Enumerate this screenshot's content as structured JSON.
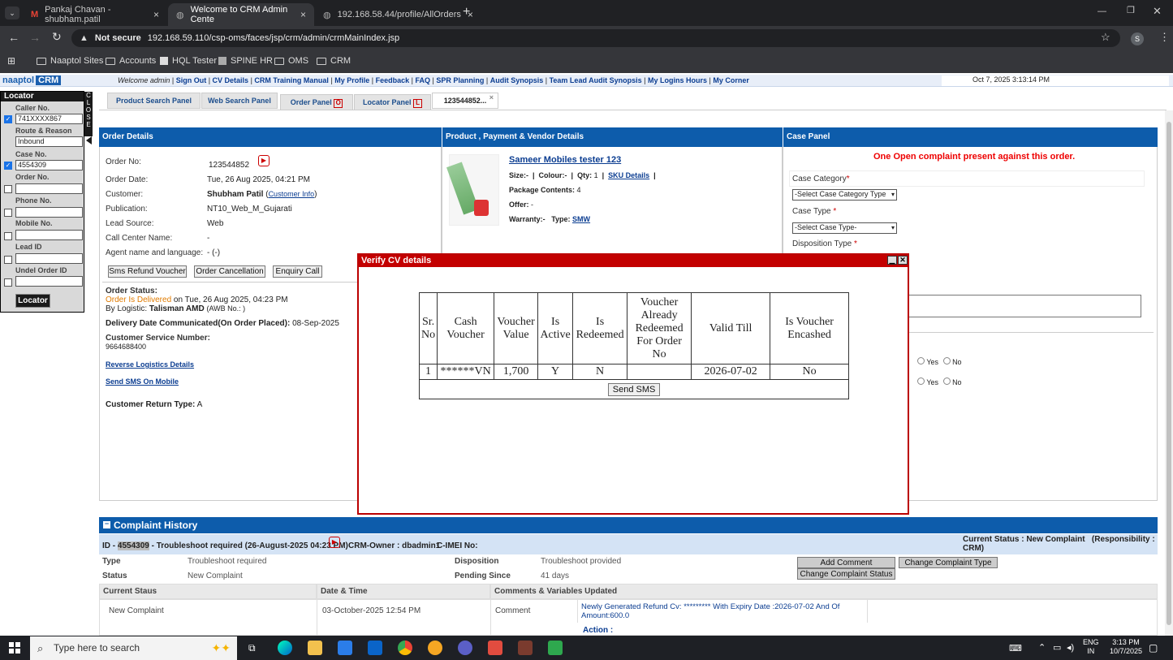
{
  "browser": {
    "tabs": [
      {
        "label": "Pankaj Chavan - shubham.patil"
      },
      {
        "label": "Welcome to CRM Admin Cente"
      },
      {
        "label": "192.168.58.44/profile/AllOrders"
      }
    ],
    "security": "Not secure",
    "url": "192.168.59.110/csp-oms/faces/jsp/crm/admin/crmMainIndex.jsp",
    "profile_initial": "S",
    "bookmarks": [
      "Naaptol Sites",
      "Accounts",
      "HQL Tester",
      "SPINE HR",
      "OMS",
      "CRM"
    ]
  },
  "app": {
    "logo_text": "naaptol",
    "logo_badge": "CRM",
    "welcome": "Welcome admin",
    "nav_links": [
      "Sign Out",
      "CV Details",
      "CRM Training Manual",
      "My Profile",
      "Feedback",
      "FAQ",
      "SPR Planning",
      "Audit Synopsis",
      "Team Lead Audit Synopsis",
      "My Logins Hours",
      "My Corner"
    ],
    "datetime": "Oct 7, 2025 3:13:14 PM"
  },
  "locator": {
    "title": "Locator",
    "close_letters": [
      "C",
      "L",
      "O",
      "S",
      "E"
    ],
    "fields": [
      {
        "label": "Caller No.",
        "value": "741XXXX867",
        "checked": true
      },
      {
        "label": "Route & Reason",
        "value": "Inbound",
        "checked": false
      },
      {
        "label": "Case No.",
        "value": "4554309",
        "checked": true
      },
      {
        "label": "Order No.",
        "value": "",
        "checked": false
      },
      {
        "label": "Phone No.",
        "value": "",
        "checked": false
      },
      {
        "label": "Mobile No.",
        "value": "",
        "checked": false
      },
      {
        "label": "Lead ID",
        "value": "",
        "checked": false
      },
      {
        "label": "Undel Order ID",
        "value": "",
        "checked": false
      }
    ],
    "button": "Locator"
  },
  "panel_tabs": [
    {
      "label": "Product Search Panel"
    },
    {
      "label": "Web Search Panel"
    },
    {
      "label": "Order Panel",
      "icon": "O"
    },
    {
      "label": "Locator Panel",
      "icon": "L"
    },
    {
      "label": "123544852...",
      "close": "×"
    }
  ],
  "order_details": {
    "header": "Order Details",
    "rows": [
      {
        "label": "Order No:",
        "value": "123544852"
      },
      {
        "label": "Order Date:",
        "value": "Tue, 26 Aug 2025, 04:21 PM"
      },
      {
        "label": "Customer:",
        "value": "Shubham Patil",
        "link": "Customer Info"
      },
      {
        "label": "Publication:",
        "value": "NT10_Web_M_Gujarati"
      },
      {
        "label": "Lead Source:",
        "value": "Web"
      },
      {
        "label": "Call Center Name:",
        "value": "-"
      },
      {
        "label": "Agent name and language:",
        "value": "- (-)"
      }
    ],
    "buttons": [
      "Sms Refund Voucher",
      "Order Cancellation",
      "Enquiry Call"
    ],
    "status_label": "Order Status:",
    "status_value": "Order Is Delivered",
    "status_rest": "on Tue, 26 Aug 2025, 04:23 PM",
    "logistic_label": "By Logistic:",
    "logistic_value": "Talisman AMD",
    "awb": "(AWB No.: )",
    "delivery_label": "Delivery Date Communicated(On Order Placed):",
    "delivery_value": "08-Sep-2025",
    "csn_label": "Customer Service Number:",
    "csn_value": "9664688400",
    "link_reverse": "Reverse Logistics Details",
    "link_sms": "Send SMS On Mobile",
    "return_label": "Customer Return Type:",
    "return_value": "A"
  },
  "product": {
    "header": "Product , Payment & Vendor Details",
    "name": "Sameer Mobiles tester 123",
    "size": "Size:-",
    "colour": "Colour:-",
    "qty_label": "Qty:",
    "qty": "1",
    "sku_link": "SKU Details",
    "package_label": "Package Contents:",
    "package_value": "4",
    "offer_label": "Offer:",
    "offer_value": "-",
    "warranty": "Warranty:-",
    "type_label": "Type:",
    "type_value": "SMW"
  },
  "case_panel": {
    "header": "Case Panel",
    "alert": "One Open complaint present against this order.",
    "category_label": "Case Category",
    "category_select": "-Select Case Category Type",
    "type_label": "Case Type",
    "type_select": "-Select Case Type-",
    "disposition_label": "Disposition Type",
    "yes": "Yes",
    "no": "No"
  },
  "dialog": {
    "title": "Verify CV details",
    "columns": [
      "Sr. No",
      "Cash Voucher",
      "Voucher Value",
      "Is Active",
      "Is Redeemed",
      "Voucher Already Redeemed For Order No",
      "Valid Till",
      "Is Voucher Encashed"
    ],
    "rows": [
      [
        "1",
        "******VN",
        "1,700",
        "Y",
        "N",
        "",
        "2026-07-02",
        "No"
      ]
    ],
    "send_button": "Send SMS"
  },
  "complaint_history": {
    "header": "Complaint History",
    "id_label": "ID -",
    "id_value": "4554309",
    "id_rest": "- Troubleshoot required (26-August-2025 04:23 PM)",
    "owner": "CRM-Owner : dbadmin1",
    "imei": "C-IMEI No:",
    "current_status": "Current Status : New Complaint",
    "responsibility": "(Responsibility : CRM)",
    "type_label": "Type",
    "type_value": "Troubleshoot required",
    "status_label": "Status",
    "status_value": "New Complaint",
    "disposition_label": "Disposition",
    "disposition_value": "Troubleshoot provided",
    "pending_label": "Pending Since",
    "pending_value": "41 days",
    "btn_add": "Add Comment",
    "btn_change_type": "Change Complaint Type",
    "btn_change_status": "Change Complaint Status",
    "grid_headers": [
      "Current Staus",
      "Date & Time",
      "Comments & Variables Updated"
    ],
    "grid_row": {
      "status": "New Complaint",
      "datetime": "03-October-2025 12:54 PM",
      "kind": "Comment",
      "text": "Newly Generated Refund Cv: ********* With Expiry Date :2026-07-02 And Of Amount:600.0"
    },
    "action_label": "Action :"
  },
  "taskbar": {
    "search_placeholder": "Type here to search",
    "lang": "ENG",
    "region": "IN",
    "time": "3:13 PM",
    "date": "10/7/2025"
  }
}
